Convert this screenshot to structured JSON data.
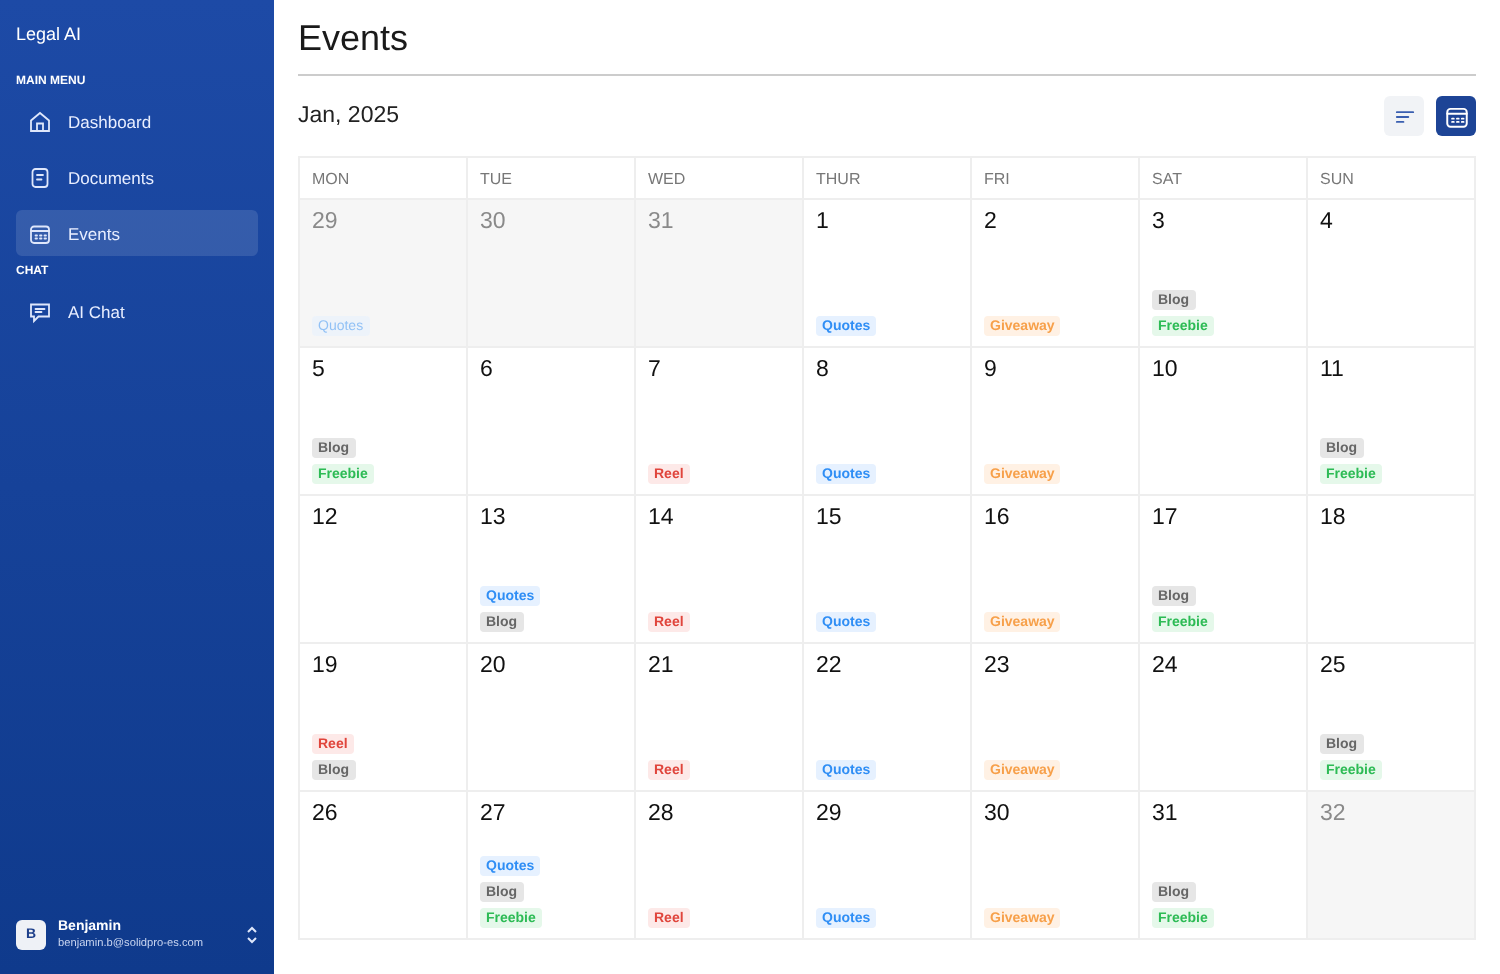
{
  "sidebar": {
    "brand": "Legal AI",
    "sections": [
      {
        "title": "MAIN MENU",
        "items": [
          {
            "label": "Dashboard",
            "kind": "home",
            "selected": false
          },
          {
            "label": "Documents",
            "kind": "doc",
            "selected": false
          },
          {
            "label": "Events",
            "kind": "calendar",
            "selected": true
          }
        ]
      },
      {
        "title": "CHAT",
        "items": [
          {
            "label": "AI Chat",
            "kind": "chat",
            "selected": false
          }
        ]
      }
    ],
    "user": {
      "initial": "B",
      "name": "Benjamin",
      "email": "benjamin.b@solidpro-es.com"
    }
  },
  "page": {
    "title": "Events",
    "month": "Jan, 2025",
    "views": [
      {
        "kind": "list",
        "selected": false
      },
      {
        "kind": "calendar",
        "selected": true
      }
    ]
  },
  "calendar": {
    "weekdays": [
      "MON",
      "TUE",
      "WED",
      "THUR",
      "FRI",
      "SAT",
      "SUN"
    ],
    "days": [
      {
        "day": "29",
        "outside": true,
        "events": [
          {
            "label": "Quotes",
            "kind": "quotes"
          }
        ]
      },
      {
        "day": "30",
        "outside": true
      },
      {
        "day": "31",
        "outside": true
      },
      {
        "day": "1",
        "outside": false,
        "events": [
          {
            "label": "Quotes",
            "kind": "quotes"
          }
        ]
      },
      {
        "day": "2",
        "outside": false,
        "events": [
          {
            "label": "Giveaway",
            "kind": "giveaway"
          }
        ]
      },
      {
        "day": "3",
        "outside": false,
        "events": [
          {
            "label": "Blog",
            "kind": "blog"
          },
          {
            "label": "Freebie",
            "kind": "freebie"
          }
        ]
      },
      {
        "day": "4",
        "outside": false
      },
      {
        "day": "5",
        "outside": false,
        "events": [
          {
            "label": "Blog",
            "kind": "blog"
          },
          {
            "label": "Freebie",
            "kind": "freebie"
          }
        ]
      },
      {
        "day": "6",
        "outside": false
      },
      {
        "day": "7",
        "outside": false,
        "events": [
          {
            "label": "Reel",
            "kind": "reel"
          }
        ]
      },
      {
        "day": "8",
        "outside": false,
        "events": [
          {
            "label": "Quotes",
            "kind": "quotes"
          }
        ]
      },
      {
        "day": "9",
        "outside": false,
        "events": [
          {
            "label": "Giveaway",
            "kind": "giveaway"
          }
        ]
      },
      {
        "day": "10",
        "outside": false
      },
      {
        "day": "11",
        "outside": false,
        "events": [
          {
            "label": "Blog",
            "kind": "blog"
          },
          {
            "label": "Freebie",
            "kind": "freebie"
          }
        ]
      },
      {
        "day": "12",
        "outside": false
      },
      {
        "day": "13",
        "outside": false,
        "events": [
          {
            "label": "Quotes",
            "kind": "quotes"
          },
          {
            "label": "Blog",
            "kind": "blog"
          }
        ]
      },
      {
        "day": "14",
        "outside": false,
        "events": [
          {
            "label": "Reel",
            "kind": "reel"
          }
        ]
      },
      {
        "day": "15",
        "outside": false,
        "events": [
          {
            "label": "Quotes",
            "kind": "quotes"
          }
        ]
      },
      {
        "day": "16",
        "outside": false,
        "events": [
          {
            "label": "Giveaway",
            "kind": "giveaway"
          }
        ]
      },
      {
        "day": "17",
        "outside": false,
        "events": [
          {
            "label": "Blog",
            "kind": "blog"
          },
          {
            "label": "Freebie",
            "kind": "freebie"
          }
        ]
      },
      {
        "day": "18",
        "outside": false
      },
      {
        "day": "19",
        "outside": false,
        "events": [
          {
            "label": "Reel",
            "kind": "reel"
          },
          {
            "label": "Blog",
            "kind": "blog"
          }
        ]
      },
      {
        "day": "20",
        "outside": false
      },
      {
        "day": "21",
        "outside": false,
        "events": [
          {
            "label": "Reel",
            "kind": "reel"
          }
        ]
      },
      {
        "day": "22",
        "outside": false,
        "events": [
          {
            "label": "Quotes",
            "kind": "quotes"
          }
        ]
      },
      {
        "day": "23",
        "outside": false,
        "events": [
          {
            "label": "Giveaway",
            "kind": "giveaway"
          }
        ]
      },
      {
        "day": "24",
        "outside": false
      },
      {
        "day": "25",
        "outside": false,
        "events": [
          {
            "label": "Blog",
            "kind": "blog"
          },
          {
            "label": "Freebie",
            "kind": "freebie"
          }
        ]
      },
      {
        "day": "26",
        "outside": false
      },
      {
        "day": "27",
        "outside": false,
        "events": [
          {
            "label": "Quotes",
            "kind": "quotes"
          },
          {
            "label": "Blog",
            "kind": "blog"
          },
          {
            "label": "Freebie",
            "kind": "freebie"
          }
        ]
      },
      {
        "day": "28",
        "outside": false,
        "events": [
          {
            "label": "Reel",
            "kind": "reel"
          }
        ]
      },
      {
        "day": "29",
        "outside": false,
        "events": [
          {
            "label": "Quotes",
            "kind": "quotes"
          }
        ]
      },
      {
        "day": "30",
        "outside": false,
        "events": [
          {
            "label": "Giveaway",
            "kind": "giveaway"
          }
        ]
      },
      {
        "day": "31",
        "outside": false,
        "events": [
          {
            "label": "Blog",
            "kind": "blog"
          },
          {
            "label": "Freebie",
            "kind": "freebie"
          }
        ]
      },
      {
        "day": "32",
        "outside": true
      }
    ]
  }
}
